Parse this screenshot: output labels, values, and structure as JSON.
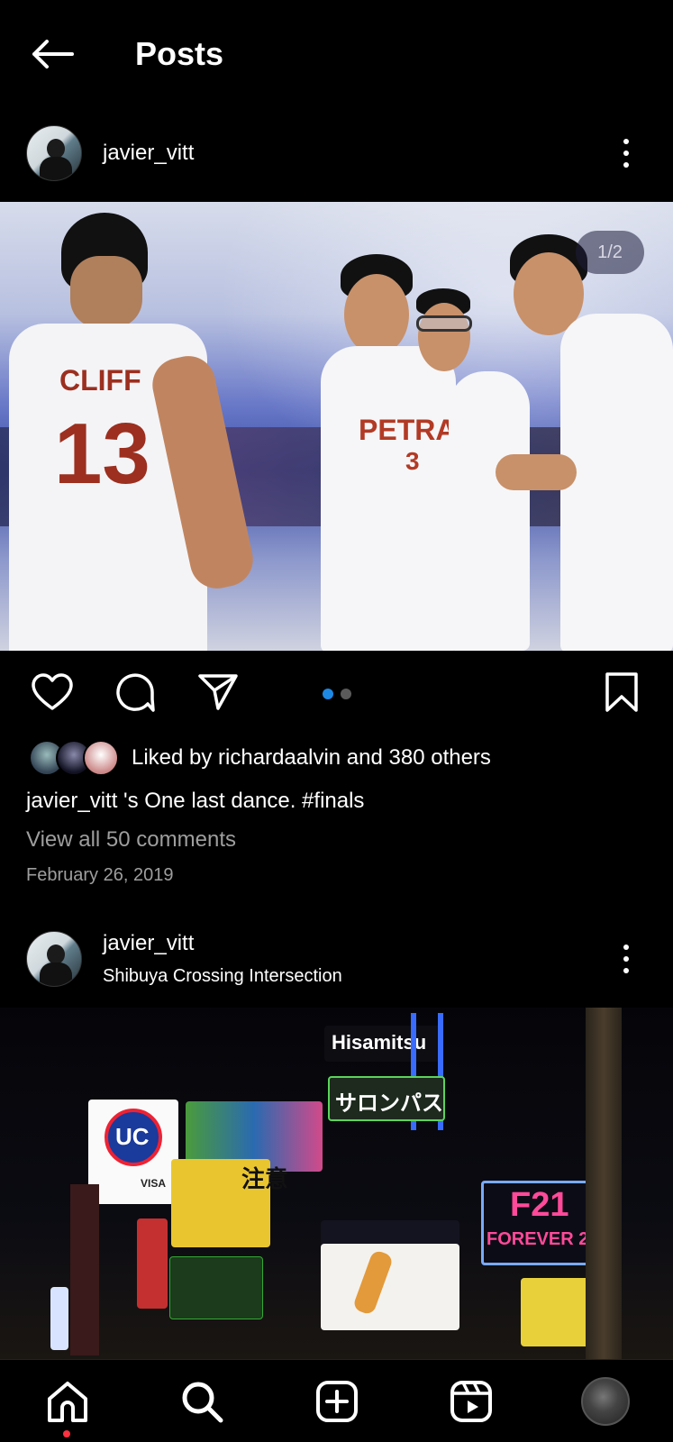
{
  "header": {
    "title": "Posts",
    "back_icon": "arrow-left-icon"
  },
  "posts": [
    {
      "username": "javier_vitt",
      "location": "",
      "image_counter": "1/2",
      "carousel": {
        "total": 2,
        "active": 1
      },
      "likes_text": "Liked by richardaalvin and 380 others",
      "caption": "javier_vitt 's One last dance. #finals",
      "view_comments": "View all 50 comments",
      "date": "February 26, 2019",
      "photo_jersey_texts": [
        "CLIFF",
        "13",
        "PETRA",
        "3"
      ]
    },
    {
      "username": "javier_vitt",
      "location": "Shibuya Crossing Intersection",
      "photo_sign_texts": [
        "Hisamitsu",
        "サロンパス",
        "UC",
        "VISA",
        "注意",
        "F21",
        "FOREVER 21"
      ]
    }
  ],
  "bottom_nav": {
    "items": [
      "home-icon",
      "search-icon",
      "create-icon",
      "reels-icon",
      "profile-avatar"
    ],
    "active": "home-icon",
    "badge_color": "#ff3040"
  },
  "colors": {
    "background": "#000000",
    "accent_blue": "#1e88e5",
    "muted_text": "#9e9e9e"
  }
}
